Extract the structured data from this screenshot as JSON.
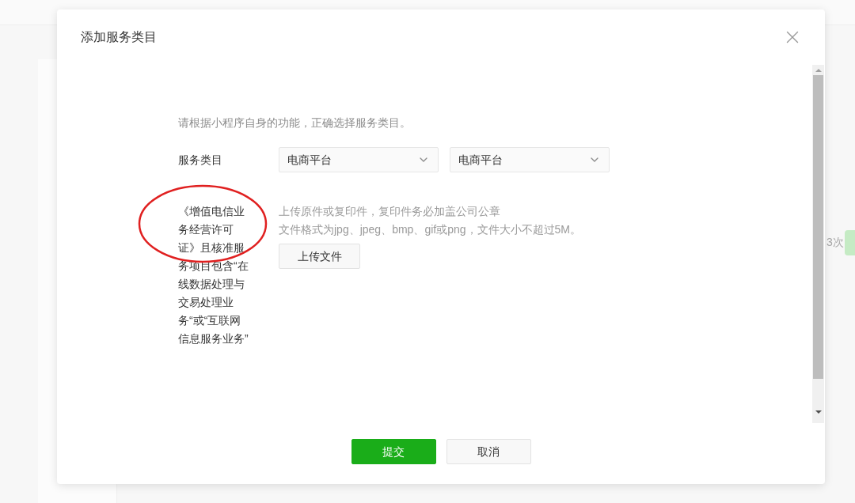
{
  "background": {
    "count_text": "3次"
  },
  "dialog": {
    "title": "添加服务类目",
    "intro": "请根据小程序自身的功能，正确选择服务类目。",
    "category": {
      "label": "服务类目",
      "selects": [
        {
          "value": "电商平台"
        },
        {
          "value": "电商平台"
        }
      ]
    },
    "qualification": {
      "label": "《增值电信业务经营许可证》且核准服务项目包含“在线数据处理与交易处理业务“或“互联网信息服务业务”",
      "hints": [
        "上传原件或复印件，复印件务必加盖公司公章",
        "文件格式为jpg、jpeg、bmp、gif或png，文件大小不超过5M。"
      ],
      "upload_button": "上传文件"
    },
    "buttons": [
      {
        "label": "提交",
        "kind": "primary"
      },
      {
        "label": "取消",
        "kind": "secondary"
      }
    ]
  }
}
